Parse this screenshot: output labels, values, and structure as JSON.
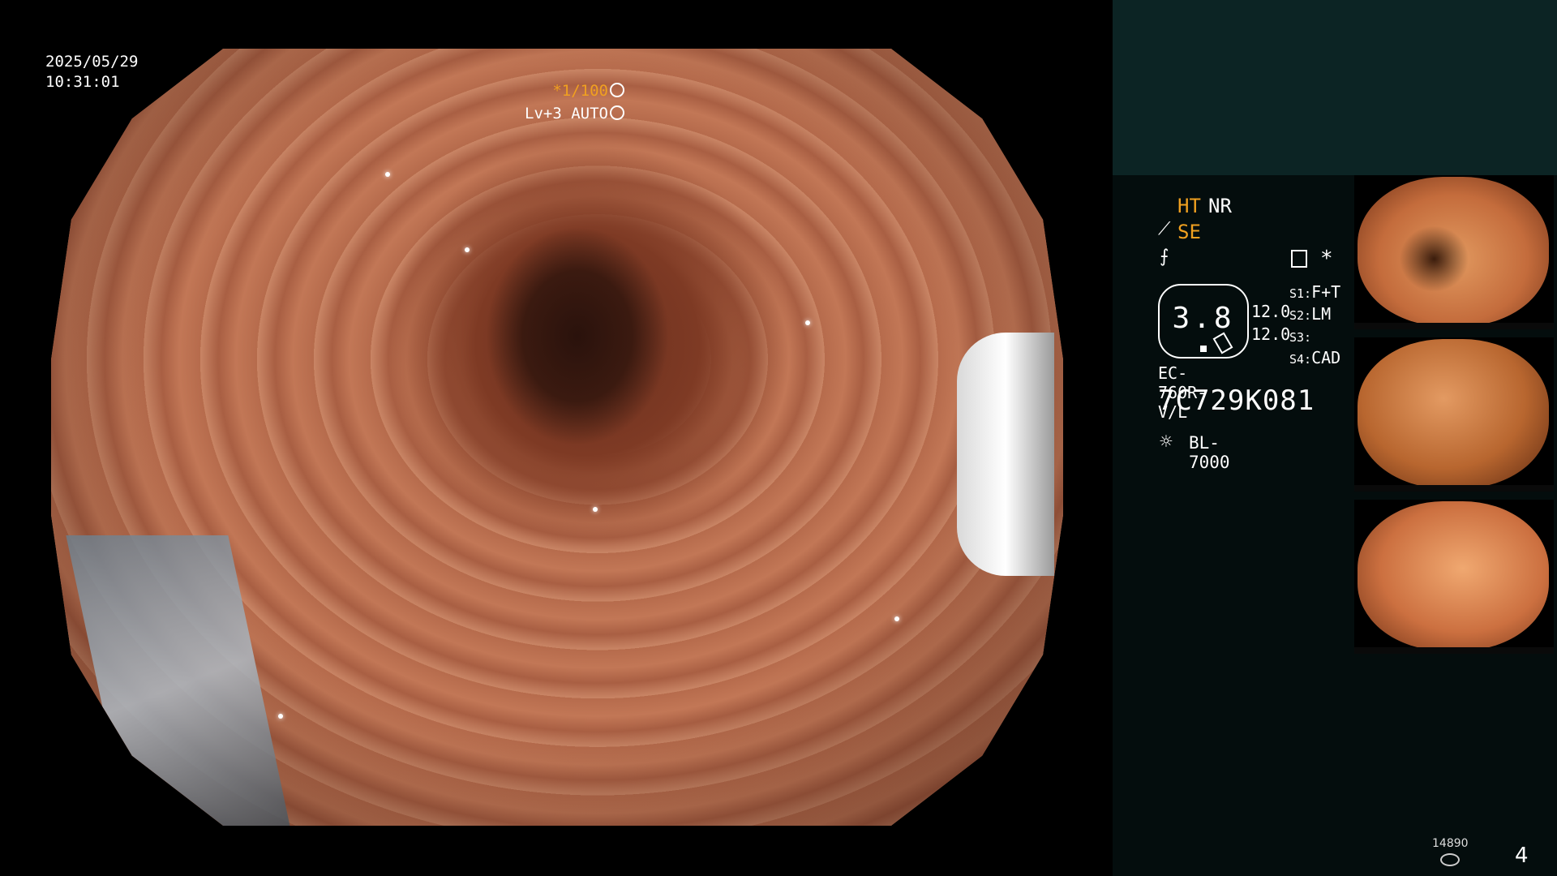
{
  "overlay": {
    "date": "2025/05/29",
    "time": "10:31:01",
    "shutter": "*1/100",
    "shutter_icon": "aperture-icon",
    "level": "Lv+3 AUTO",
    "level_icon": "iris-icon"
  },
  "panel": {
    "ht": "HT",
    "nr": "NR",
    "se": "SE",
    "star": "*",
    "gauge_value": "3.8",
    "val_a": "12.0",
    "val_b": "12.0",
    "s1_key": "S1:",
    "s1_val": "F+T",
    "s2_key": "S2:",
    "s2_val": "LM",
    "s3_key": "S3:",
    "s3_val": "",
    "s4_key": "S4:",
    "s4_val": "CAD",
    "model": "EC-760R-V/L",
    "serial": "7C729K081",
    "light_icon": "sun-icon",
    "light": "BL-7000"
  },
  "thumbnails": [
    {
      "label": "captured frame 1"
    },
    {
      "label": "captured frame 2"
    },
    {
      "label": "captured frame 3"
    }
  ],
  "footer": {
    "count": "14890",
    "page": "4"
  },
  "colors": {
    "accent": "#f0a020",
    "panel_bg": "#040d0d",
    "panel_top": "#0c2424"
  }
}
